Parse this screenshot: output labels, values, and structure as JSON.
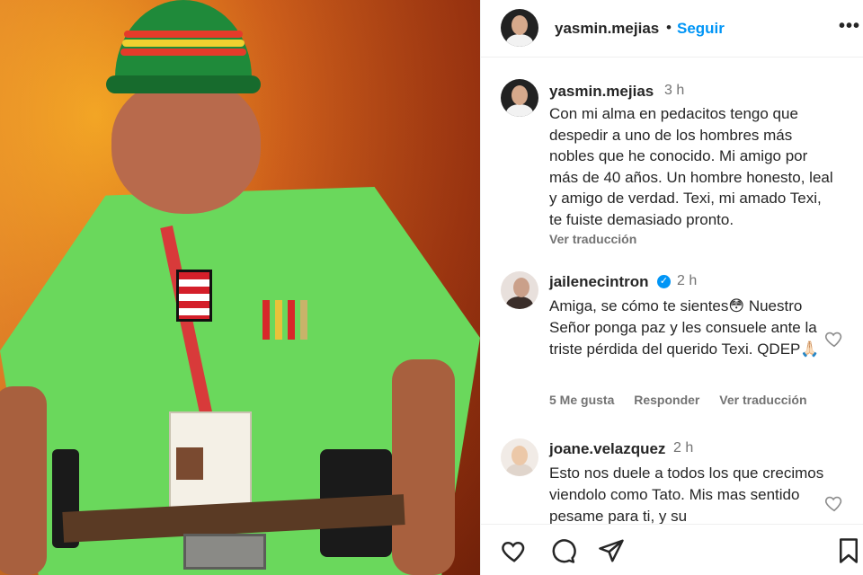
{
  "post": {
    "header": {
      "username": "yasmin.mejias",
      "separator": "•",
      "follow_label": "Seguir",
      "more_label": "•••"
    },
    "caption": {
      "username": "yasmin.mejias",
      "time": "3 h",
      "text": "Con mi alma en pedacitos tengo que despedir a uno de los hombres más nobles que he conocido. Mi amigo por más de 40 años. Un hombre honesto, leal y amigo de verdad. Texi, mi amado Texi, te fuiste demasiado pronto.",
      "translate_label": "Ver traducción"
    },
    "comments": [
      {
        "username": "jailenecintron",
        "verified": true,
        "time": "2 h",
        "text": "Amiga, se cómo te sientes😳 Nuestro Señor ponga paz y les consuele ante la triste pérdida del querido Texi. QDEP🙏🏻",
        "likes_label": "5 Me gusta",
        "reply_label": "Responder",
        "translate_label": "Ver traducción"
      },
      {
        "username": "joane.velazquez",
        "verified": false,
        "time": "2 h",
        "text": "Esto nos duele a todos los que crecimos viendolo como Tato. Mis mas sentido pesame para ti, y su"
      }
    ],
    "actions": [
      "heart-icon",
      "comment-icon",
      "share-icon",
      "bookmark-icon"
    ],
    "colors": {
      "accent": "#0095f6",
      "muted": "#737373",
      "text": "#262626"
    }
  }
}
